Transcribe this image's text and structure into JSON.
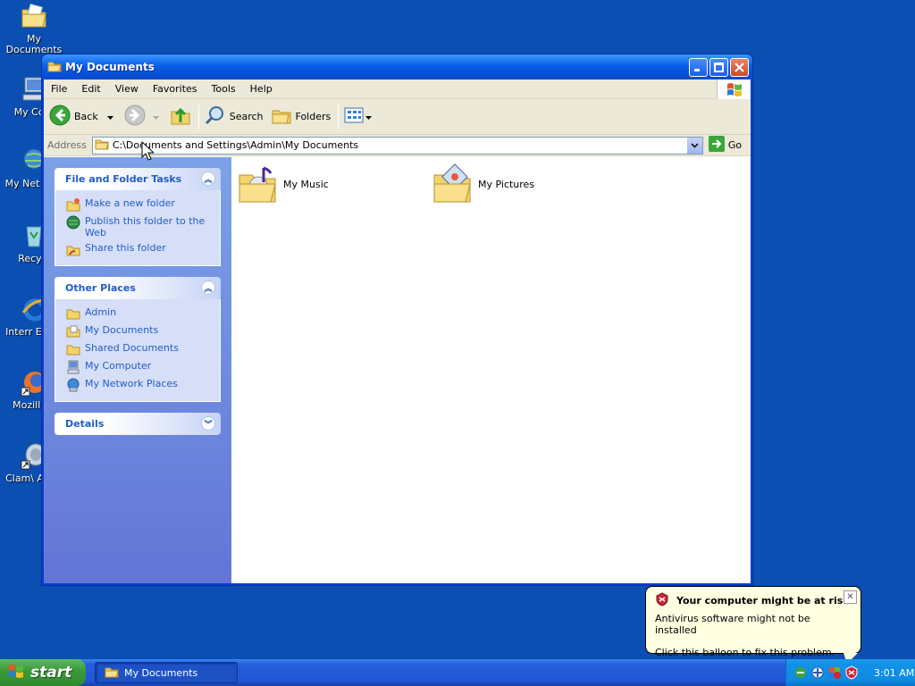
{
  "desktop": {
    "icons": [
      {
        "label": "My Documents"
      },
      {
        "label": "My Com"
      },
      {
        "label": "My Net Plac"
      },
      {
        "label": "Recycl"
      },
      {
        "label": "Interr Explo"
      },
      {
        "label": "Mozilla F"
      },
      {
        "label": "Clam\\ Antiv"
      }
    ]
  },
  "window": {
    "title": "My Documents",
    "menu": [
      "File",
      "Edit",
      "View",
      "Favorites",
      "Tools",
      "Help"
    ],
    "toolbar": {
      "back": "Back",
      "search": "Search",
      "folders": "Folders"
    },
    "address": {
      "label": "Address",
      "value": "C:\\Documents and Settings\\Admin\\My Documents",
      "go": "Go"
    },
    "taskpane": {
      "file_tasks": {
        "title": "File and Folder Tasks",
        "items": [
          "Make a new folder",
          "Publish this folder to the Web",
          "Share this folder"
        ]
      },
      "other_places": {
        "title": "Other Places",
        "items": [
          "Admin",
          "My Documents",
          "Shared Documents",
          "My Computer",
          "My Network Places"
        ]
      },
      "details": {
        "title": "Details"
      }
    },
    "files": [
      {
        "name": "My Music"
      },
      {
        "name": "My Pictures"
      }
    ]
  },
  "balloon": {
    "title": "Your computer might be at risk",
    "line1": "Antivirus software might not be installed",
    "line2": "Click this balloon to fix this problem."
  },
  "taskbar": {
    "start": "start",
    "task": "My Documents",
    "clock": "3:01 AM"
  }
}
